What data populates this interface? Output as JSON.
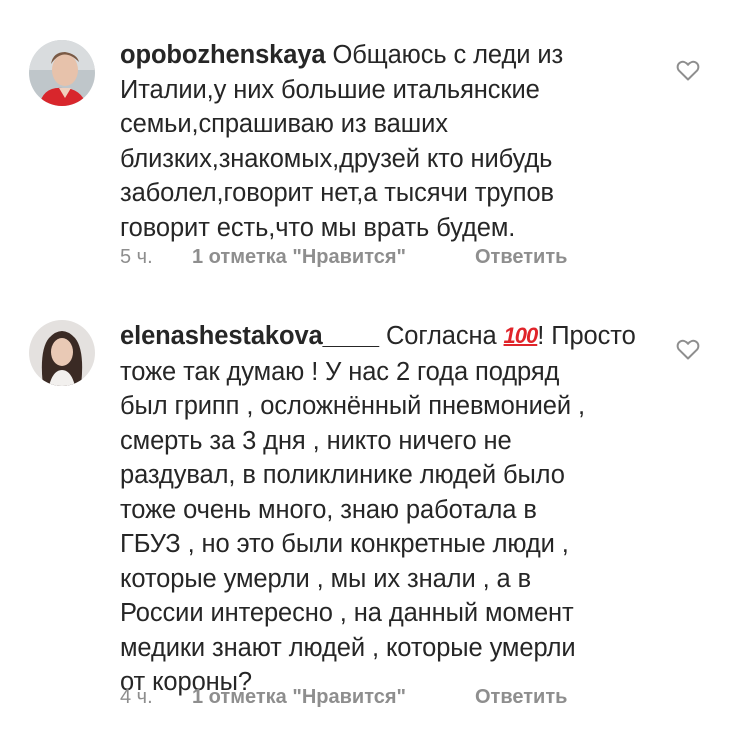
{
  "comments": [
    {
      "username": "opobozhenskaya",
      "first_line_rest": " Общаюсь с леди из",
      "lines": [
        "Италии,у них большие итальянские",
        "семьи,спрашиваю из ваших",
        "близких,знакомых,друзей кто нибудь",
        "заболел,говорит нет,а тысячи трупов",
        "говорит есть,что мы врать будем."
      ],
      "time": "5 ч.",
      "likes": "1 отметка \"Нравится\"",
      "reply": "Ответить",
      "avatar_icon": "user-avatar-photo"
    },
    {
      "username": "elenashestakova____",
      "first_line_rest_a": "  Согласна ",
      "emoji": "💯",
      "first_line_rest_b": "! Просто",
      "lines": [
        "тоже так думаю ! У нас 2 года подряд",
        "был грипп , осложнённый пневмонией ,",
        "смерть за 3 дня , никто ничего не",
        "раздувал, в поликлинике людей было",
        "тоже очень много, знаю работала  в",
        "ГБУЗ , но это были конкретные люди ,",
        "которые умерли , мы их знали , а в",
        "России интересно , на данный момент",
        "медики знают людей , которые умерли",
        "от короны?"
      ],
      "time": "4 ч.",
      "likes": "1 отметка \"Нравится\"",
      "reply": "Ответить",
      "avatar_icon": "user-avatar-photo"
    }
  ],
  "heart_icon": "heart-outline-icon",
  "colors": {
    "text": "#262626",
    "meta": "#8e8e8e",
    "emoji": "#e0242a"
  }
}
